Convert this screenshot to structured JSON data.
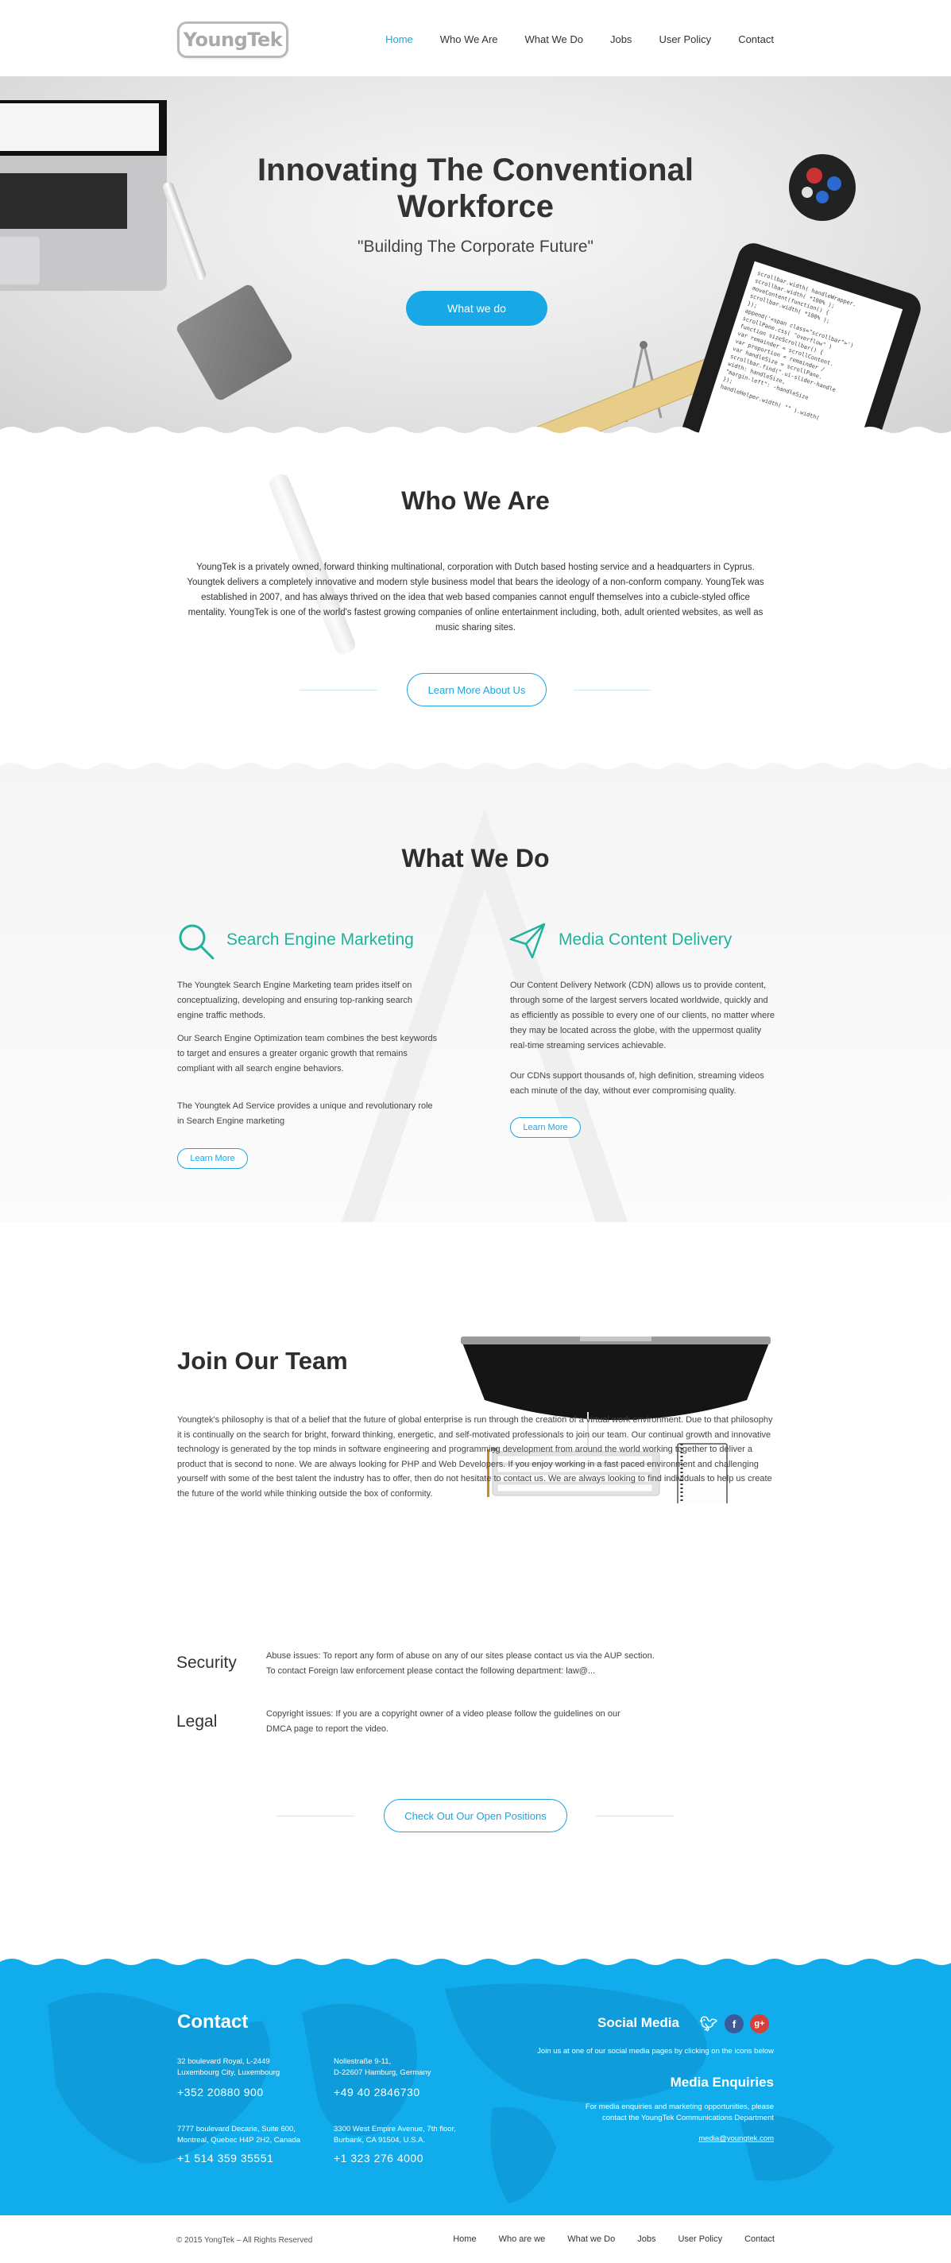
{
  "header": {
    "logo_text": "YoungTek",
    "nav": [
      "Home",
      "Who We Are",
      "What We Do",
      "Jobs",
      "User Policy",
      "Contact"
    ]
  },
  "hero": {
    "title_line1": "Innovating The Conventional",
    "title_line2": "Workforce",
    "subtitle": "\"Building The Corporate Future\"",
    "cta": "What we do",
    "tablet_code": [
      "scrollbar.width( handleWrapper.",
      "",
      "scrollbar.width( *100% );",
      "",
      "moveContent(function() {",
      "  scrollbar.width( *100% );",
      "});",
      "",
      "append('<span class=\"scrollbar\">')",
      "",
      "scrollPane.css( \"overflow\" )",
      "",
      "function sizeScrollbar() {",
      "  var remainder = scrollContent.",
      "  var proportion = remainder /",
      "  var handleSize = scrollPane.",
      "  scrollbar.find(\".ui-slider-handle",
      "    width: handleSize,",
      "    \"margin-left\": -handleSize",
      "  });",
      "  handleHelper.width( \"\" ).width("
    ]
  },
  "who": {
    "title": "Who We Are",
    "text": "YoungTek is a privately owned, forward thinking multinational, corporation with Dutch based hosting service and a headquarters in Cyprus. Youngtek delivers a completely innovative and modern style business model that bears the ideology of a non-conform company. YoungTek was established in 2007, and has always thrived on the idea that web based companies cannot engulf themselves into a cubicle-styled office mentality. YoungTek is one of the world's fastest growing companies of online entertainment including, both, adult oriented websites, as well as music sharing sites.",
    "button": "Learn More About Us"
  },
  "what": {
    "title": "What We Do",
    "left": {
      "title": "Search Engine Marketing",
      "p1": "The Youngtek Search Engine Marketing team prides itself on conceptualizing, developing and ensuring top-ranking search engine traffic methods.",
      "p2": "Our Search Engine Optimization team combines the best keywords to target and ensures a greater organic growth that remains compliant with all search engine behaviors.",
      "p3": "The Youngtek Ad Service provides a unique and revolutionary role in Search Engine marketing",
      "button": "Learn More"
    },
    "right": {
      "title": "Media Content Delivery",
      "p1": "Our Content Delivery Network (CDN) allows us to provide content, through some of the largest servers located worldwide, quickly and as efficiently as possible to every one of our clients, no matter where they may be located across the globe, with the uppermost quality real-time streaming services achievable.",
      "p2": "Our CDNs support thousands of, high definition, streaming videos each minute of the day, without ever compromising quality.",
      "button": "Learn More"
    }
  },
  "join": {
    "title": "Join Our Team",
    "text": "Youngtek's philosophy is that of a belief that the future of global enterprise is run through the creation of a virtual work environment. Due to that philosophy it is continually on the search for bright, forward thinking, energetic, and self-motivated professionals to join our team. Our continual growth and innovative technology is generated by the top minds in software engineering and programming development from around the world working together to deliver a product that is second to none. We are always looking for PHP and Web Developers. If you enjoy working in a fast paced environment and challenging yourself with some of the best talent the industry has to offer, then do not hesitate to contact us. We are always looking to find individuals to help us create the future of the world while thinking outside the box of conformity.",
    "security_label": "Security",
    "security_text_1": "Abuse issues: To report any form of abuse on any of our sites please contact us via the AUP section.",
    "security_text_2": "To contact Foreign law enforcement please contact the following department: law@...",
    "legal_label": "Legal",
    "legal_text": "Copyright issues: If you are a copyright owner of a video please follow the guidelines on our DMCA page to report the video.",
    "button": "Check Out Our Open Positions"
  },
  "footer": {
    "contact_title": "Contact",
    "addr1": [
      "32 boulevard Royal, L-2449",
      "Luxembourg City, Luxembourg"
    ],
    "phone1": "+352 20880 900",
    "addr2": [
      "Nollestraße 9-11,",
      "D-22607 Hamburg, Germany"
    ],
    "phone2": "+49 40 2846730",
    "addr3": [
      "7777 boulevard Decarie, Suite 600,",
      "Montreal, Quebec H4P 2H2, Canada"
    ],
    "phone3": "+1 514 359 35551",
    "addr4": [
      "3300 West Empire Avenue, 7th floor,",
      "Burbank, CA 91504, U.S.A."
    ],
    "phone4": "+1 323 276 4000",
    "social_title": "Social Media",
    "social_text": "Join us at one of our social media pages by clicking on the icons below",
    "media_title": "Media Enquiries",
    "media_text_1": "For media enquiries and marketing opportunities, please",
    "media_text_2": "contact the YoungTek Communications Department",
    "media_email": "media@youngtek.com"
  },
  "bottom": {
    "copyright": "© 2015 YongTek – All Rights Reserved",
    "nav": [
      "Home",
      "Who are we",
      "What we Do",
      "Jobs",
      "User Policy",
      "Contact"
    ]
  },
  "colors": {
    "accent": "#1aa6e0",
    "teal": "#20b39a",
    "footer_bg": "#10acec"
  }
}
